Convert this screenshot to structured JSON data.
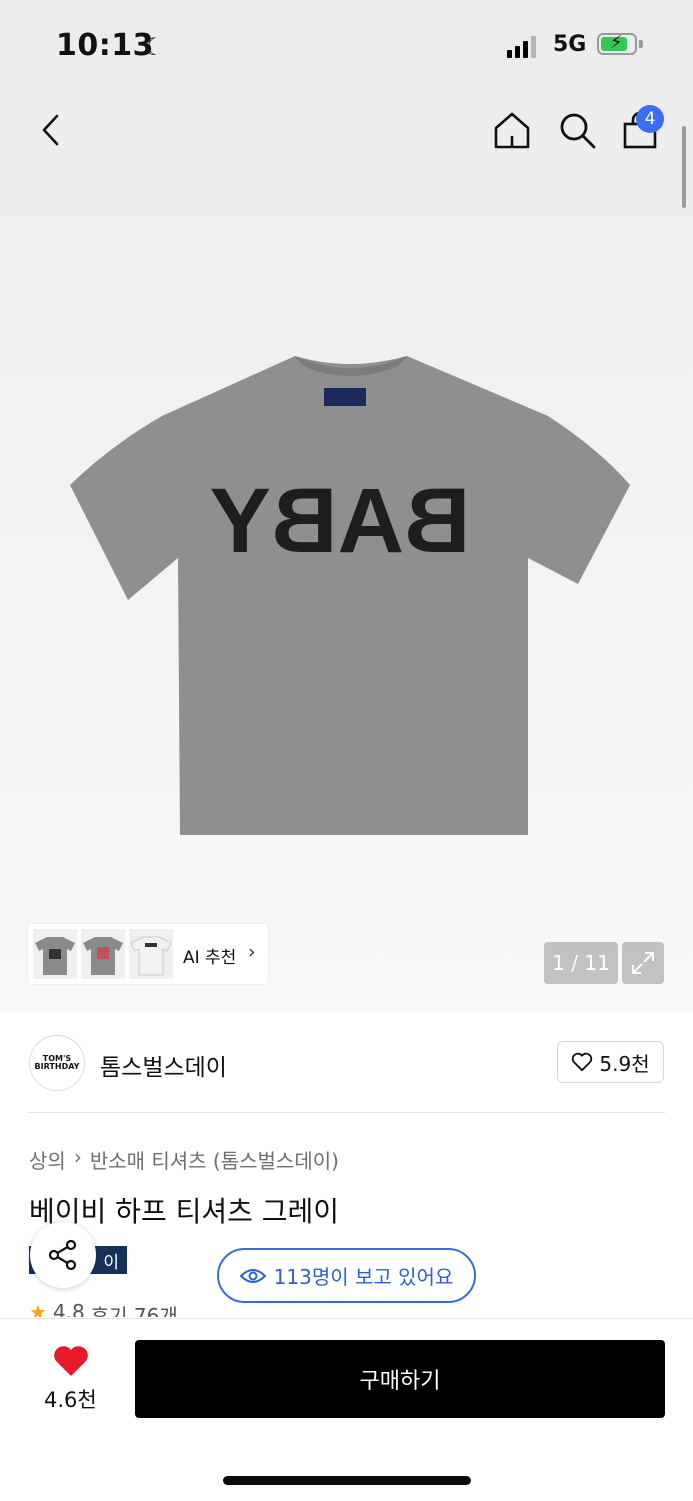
{
  "status_bar": {
    "time": "10:13",
    "network": "5G"
  },
  "header": {
    "cart_count": "4"
  },
  "product_image": {
    "print_text": "BABY"
  },
  "gallery": {
    "ai_label": "AI 추천",
    "page_indicator": "1 / 11"
  },
  "brand": {
    "name": "톰스벌스데이",
    "logo_line1": "TOM'S",
    "logo_line2": "BIRTHDAY",
    "likes": "5.9천"
  },
  "product": {
    "breadcrumb": [
      "상의",
      "반소매 티셔츠 (톰스벌스데이)"
    ],
    "title": "베이비 하프 티셔츠 그레이",
    "tag": "이",
    "viewers": "113명이 보고 있어요",
    "rating": "4.8",
    "reviews": "후기 76개"
  },
  "bottom": {
    "likes": "4.6천",
    "buy_label": "구매하기"
  },
  "colors": {
    "accent_blue": "#3b6ef5",
    "viewer_blue": "#2f5fd0",
    "heart_red": "#e8192c",
    "tag_navy": "#15325a"
  }
}
